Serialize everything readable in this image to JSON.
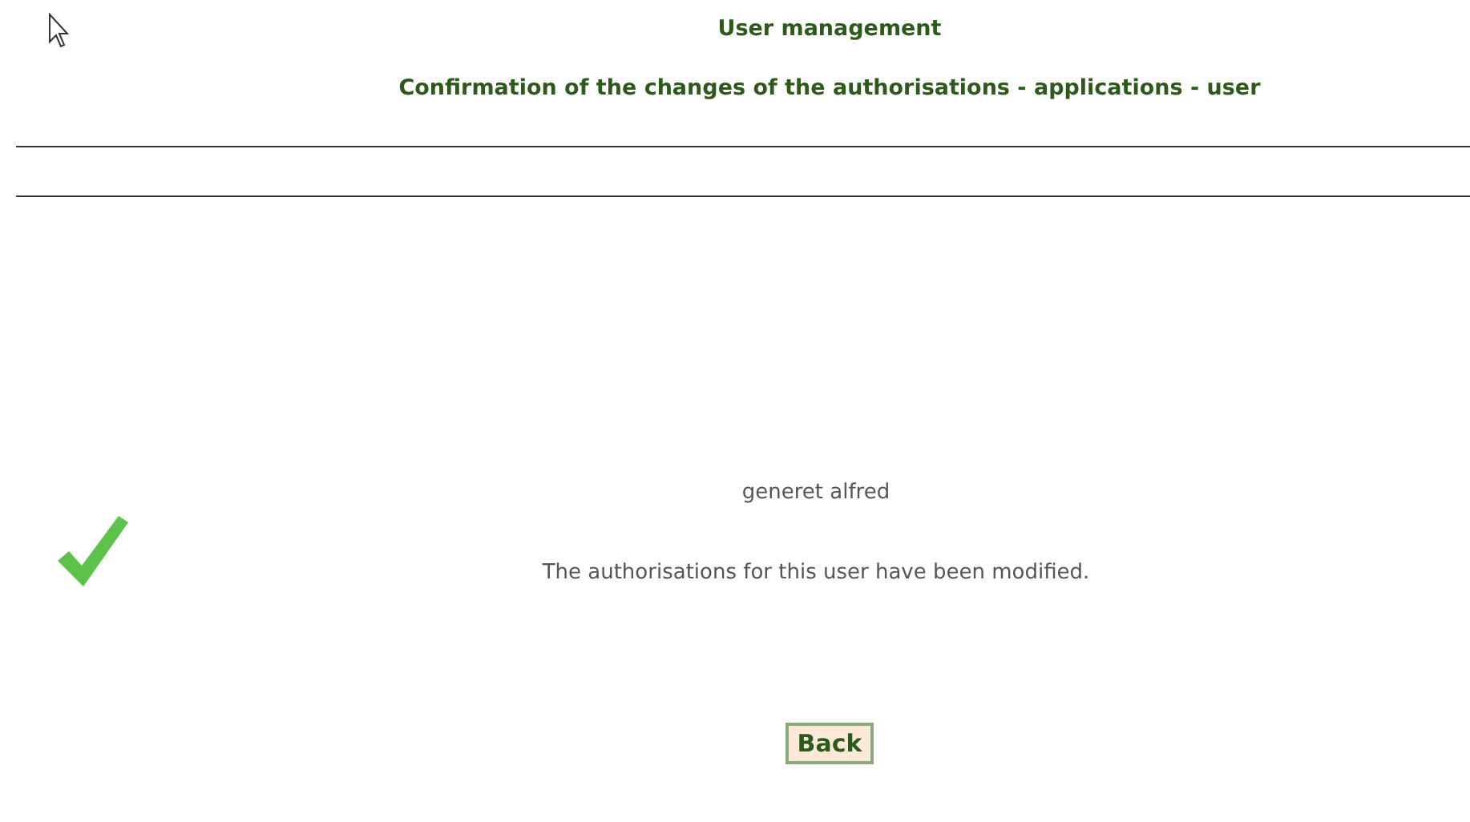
{
  "header": {
    "title": "User management",
    "subtitle": "Confirmation of the changes of the authorisations - applications - user"
  },
  "message": {
    "user": "generet alfred",
    "text": "The authorisations for this user have been modified."
  },
  "buttons": [
    {
      "label": "Back"
    }
  ]
}
